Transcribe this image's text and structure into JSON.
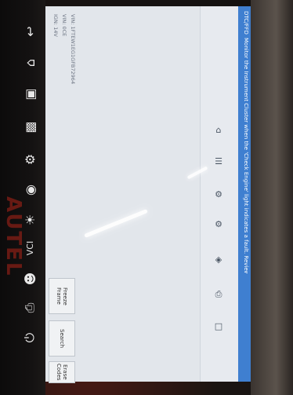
{
  "header": {
    "title": "DTC/FFD"
  },
  "banner": {
    "message": "Monitor the Instrument Cluster when the 'Check Engine' light indicates a fault. Review the freeze frame diagnostic information."
  },
  "vehicle_info": {
    "vin": "VIN: 1FTEW1EG1GFB72964",
    "info2": "VIN: 0CE",
    "info3": "IGN: 14V"
  },
  "buttons": {
    "freeze_frame": "Freeze Frame",
    "search": "Search",
    "erase_codes": "Erase Codes"
  },
  "brand_text": "AUTEL",
  "nav_icons": [
    "back-icon",
    "home-icon",
    "car-icon",
    "grid-icon",
    "settings-icon",
    "camera-icon",
    "brightness-icon",
    "vci-icon",
    "user-icon",
    "print-icon",
    "power-icon"
  ]
}
